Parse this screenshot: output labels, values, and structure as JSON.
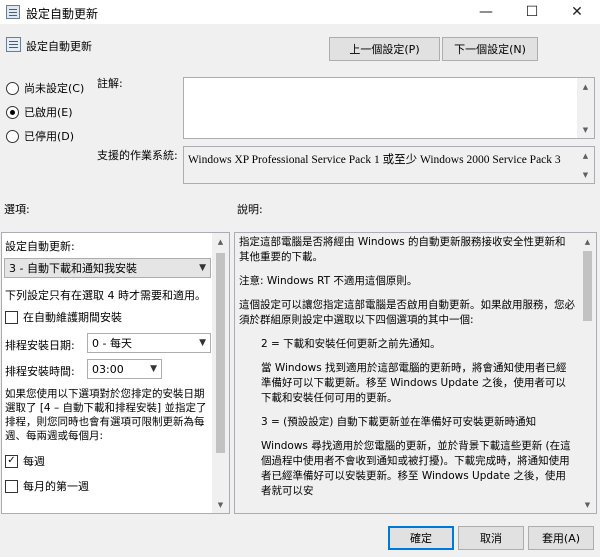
{
  "window": {
    "title": "設定自動更新",
    "minimize_glyph": "—",
    "maximize_glyph": "☐",
    "close_glyph": "✕"
  },
  "header": {
    "title": "設定自動更新"
  },
  "nav": {
    "prev_label": "上一個設定(P)",
    "next_label": "下一個設定(N)"
  },
  "state": {
    "options": [
      {
        "label": "尚未設定(C)",
        "checked": false
      },
      {
        "label": "已啟用(E)",
        "checked": true
      },
      {
        "label": "已停用(D)",
        "checked": false
      }
    ]
  },
  "comment": {
    "label": "註解:",
    "value": ""
  },
  "supported": {
    "label": "支援的作業系統:",
    "value": "Windows XP Professional Service Pack 1 或至少 Windows 2000 Service Pack 3"
  },
  "options_label": "選項:",
  "help_label": "說明:",
  "options_panel": {
    "configure_label": "設定自動更新:",
    "configure_value": "3 - 自動下載和通知我安裝",
    "note": "下列設定只有在選取 4 時才需要和適用。",
    "maint_label": "在自動維護期間安裝",
    "sched_day_label": "排程安裝日期:",
    "sched_day_value": "0 - 每天",
    "sched_time_label": "排程安裝時間:",
    "sched_time_value": "03:00",
    "para": "如果您使用以下選項對於您排定的安裝日期選取了 [4 – 自動下載和排程安裝] 並指定了排程，則您同時也會有選項可限制更新為每週、每兩週或每個月:",
    "weekly_label": "每週",
    "weekly_checked": true,
    "first_week_label": "每月的第一週"
  },
  "help_text": [
    "指定這部電腦是否將經由 Windows 的自動更新服務接收安全性更新和其他重要的下載。",
    "注意: Windows RT 不適用這個原則。",
    "這個設定可以讓您指定這部電腦是否啟用自動更新。如果啟用服務，您必須於群組原則設定中選取以下四個選項的其中一個:",
    "2 = 下載和安裝任何更新之前先通知。",
    "當 Windows 找到適用於這部電腦的更新時，將會通知使用者已經準備好可以下載更新。移至 Windows Update 之後，使用者可以下載和安裝任何可用的更新。",
    "3 = (預設設定) 自動下載更新並在準備好可安裝更新時通知",
    "Windows 尋找適用於您電腦的更新，並於背景下載這些更新 (在這個過程中使用者不會收到通知或被打擾)。下載完成時，將通知使用者已經準備好可以安裝更新。移至 Windows Update 之後，使用者就可以安"
  ],
  "footer": {
    "ok_label": "確定",
    "cancel_label": "取消",
    "apply_label": "套用(A)"
  }
}
